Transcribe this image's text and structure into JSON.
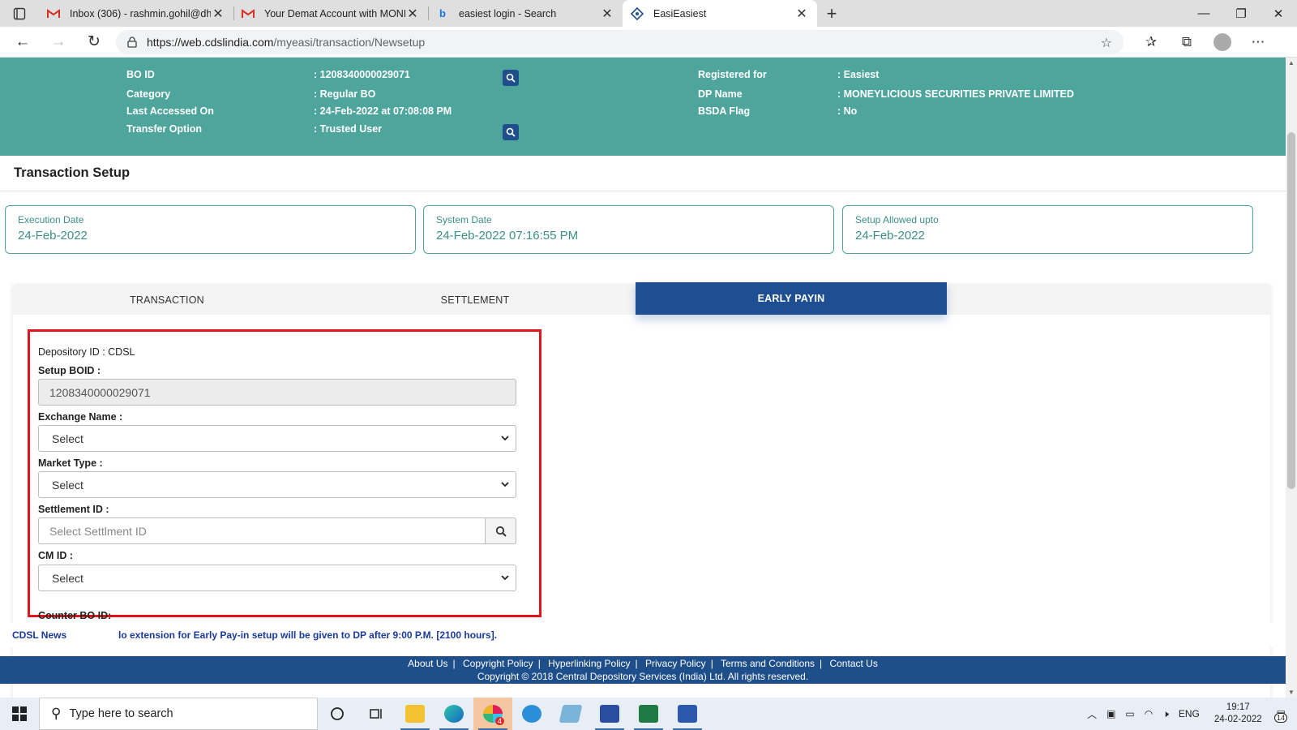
{
  "browser": {
    "tabs": [
      {
        "title": "Inbox (306) - rashmin.gohil@dha",
        "icon": "gmail-icon",
        "active": false
      },
      {
        "title": "Your Demat Account with MONE",
        "icon": "gmail-icon",
        "active": false
      },
      {
        "title": "easiest login - Search",
        "icon": "bing-icon",
        "active": false
      },
      {
        "title": "EasiEasiest",
        "icon": "cdsl-icon",
        "active": true
      }
    ],
    "url_host": "https://web.cdslindia.com",
    "url_path": "/myeasi/transaction/Newsetup"
  },
  "bo_info": {
    "bo_id_label": "BO ID",
    "bo_id_value": ": 1208340000029071",
    "category_label": "Category",
    "category_value": ": Regular BO",
    "last_accessed_label": "Last Accessed On",
    "last_accessed_value": ": 24-Feb-2022 at 07:08:08 PM",
    "transfer_option_label": "Transfer Option",
    "transfer_option_value": ": Trusted User",
    "registered_for_label": "Registered for",
    "registered_for_value": ": Easiest",
    "dp_name_label": "DP Name",
    "dp_name_value": ": MONEYLICIOUS SECURITIES PRIVATE LIMITED",
    "bsda_label": "BSDA Flag",
    "bsda_value": ": No"
  },
  "page": {
    "title": "Transaction Setup"
  },
  "date_cards": {
    "execution_label": "Execution Date",
    "execution_value": "24-Feb-2022",
    "system_label": "System Date",
    "system_value": "24-Feb-2022 07:16:55 PM",
    "setup_label": "Setup Allowed upto",
    "setup_value": "24-Feb-2022"
  },
  "panel_tabs": {
    "transaction": "TRANSACTION",
    "settlement": "SETTLEMENT",
    "early_payin": "EARLY PAYIN",
    "active": "early_payin"
  },
  "form": {
    "depository_id": "Depository ID : CDSL",
    "setup_boid_label": "Setup BOID :",
    "setup_boid_value": "1208340000029071",
    "exchange_label": "Exchange Name :",
    "exchange_value": "Select",
    "market_type_label": "Market Type :",
    "market_type_value": "Select",
    "settlement_id_label": "Settlement ID :",
    "settlement_id_placeholder": "Select Settlment ID",
    "cm_id_label": "CM ID :",
    "cm_id_value": "Select",
    "counter_bo_label": "Counter BO ID:"
  },
  "news": {
    "label": "CDSL News",
    "text": "lo extension for Early Pay-in setup will be given to DP after 9:00 P.M. [2100 hours]."
  },
  "footer": {
    "links": [
      "About Us",
      "Copyright Policy",
      "Hyperlinking Policy",
      "Privacy Policy",
      "Terms and Conditions",
      "Contact Us"
    ],
    "copyright": "Copyright © 2018 Central Depository Services (India) Ltd. All rights reserved."
  },
  "taskbar": {
    "search_placeholder": "Type here to search",
    "language": "ENG",
    "time": "19:17",
    "date": "24-02-2022",
    "notification_count": "14",
    "slack_badge": "4"
  },
  "colors": {
    "header_teal": "#4ea59c",
    "brand_blue": "#1e4f8a",
    "active_tab_blue": "#1e4f93",
    "highlight_red": "#e0151c",
    "news_blue": "#1a3a9c"
  }
}
